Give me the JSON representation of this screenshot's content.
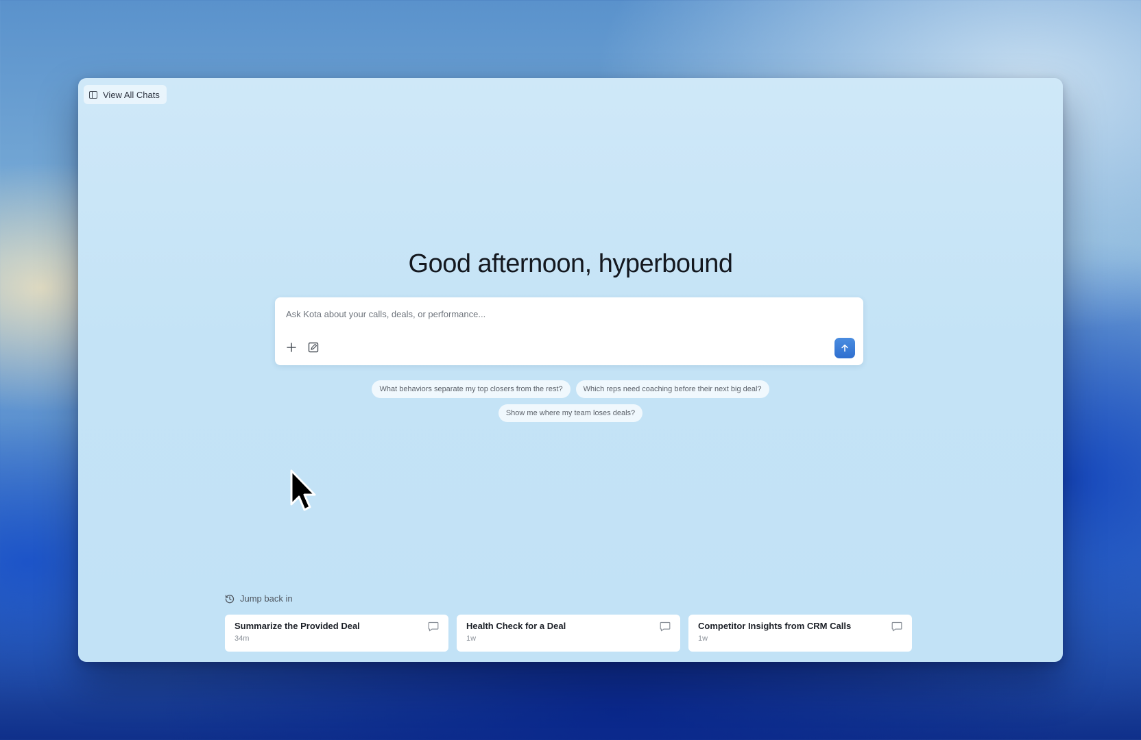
{
  "sidebar_toggle": {
    "label": "View All Chats",
    "icon": "sidebar-icon"
  },
  "greeting": "Good afternoon, hyperbound",
  "composer": {
    "placeholder": "Ask Kota about your calls, deals, or performance...",
    "value": "",
    "add_icon": "plus-icon",
    "edit_icon": "edit-square-icon",
    "send_icon": "arrow-up-icon"
  },
  "suggestions": [
    "What behaviors separate my top closers from the rest?",
    "Which reps need coaching before their next big deal?",
    "Show me where my team loses deals?"
  ],
  "recent": {
    "label": "Jump back in",
    "icon": "history-icon",
    "chats": [
      {
        "title": "Summarize the Provided Deal",
        "time": "34m"
      },
      {
        "title": "Health Check for a Deal",
        "time": "1w"
      },
      {
        "title": "Competitor Insights from CRM Calls",
        "time": "1w"
      }
    ]
  },
  "colors": {
    "accent": "#2f6fcf",
    "panel": "#c4e3f6",
    "text": "#14181f"
  }
}
